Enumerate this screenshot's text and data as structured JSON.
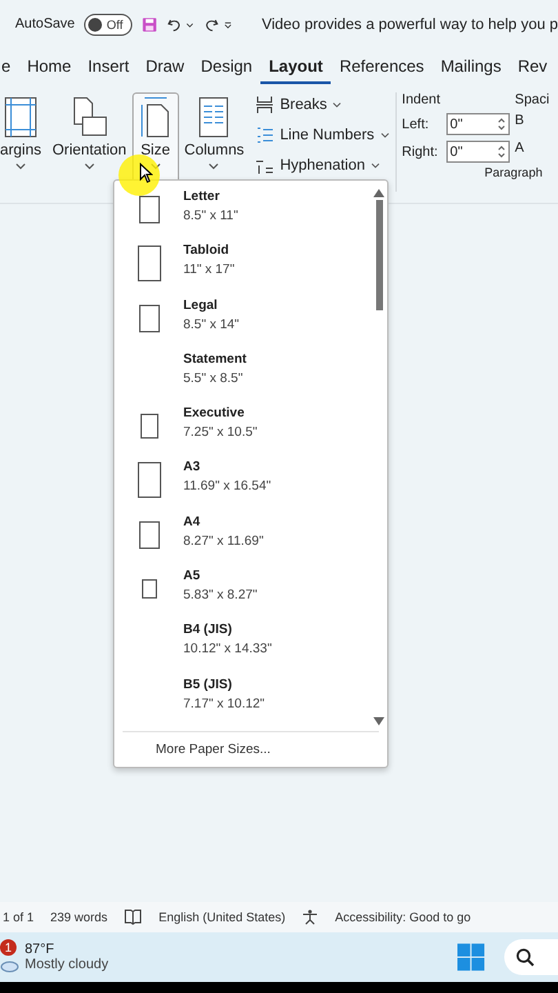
{
  "title_bar": {
    "autosave_label": "AutoSave",
    "autosave_toggle": {
      "on": false,
      "label": "Off"
    },
    "document_title": "Video provides a powerful way to help you p"
  },
  "tabs": [
    {
      "label": "e",
      "selected": false
    },
    {
      "label": "Home",
      "selected": false
    },
    {
      "label": "Insert",
      "selected": false
    },
    {
      "label": "Draw",
      "selected": false
    },
    {
      "label": "Design",
      "selected": false
    },
    {
      "label": "Layout",
      "selected": true
    },
    {
      "label": "References",
      "selected": false
    },
    {
      "label": "Mailings",
      "selected": false
    },
    {
      "label": "Rev",
      "selected": false
    }
  ],
  "ribbon": {
    "big_buttons": [
      {
        "label": "argins",
        "kind": "margins",
        "selected": false
      },
      {
        "label": "Orientation",
        "kind": "orientation",
        "selected": false
      },
      {
        "label": "Size",
        "kind": "size",
        "selected": true
      },
      {
        "label": "Columns",
        "kind": "columns",
        "selected": false
      }
    ],
    "small_buttons": [
      {
        "label": "Breaks",
        "kind": "breaks"
      },
      {
        "label": "Line Numbers",
        "kind": "lines"
      },
      {
        "label": "Hyphenation",
        "kind": "hyphen"
      }
    ],
    "indent": {
      "heading": "Indent",
      "left_label": "Left:",
      "left_value": "0\"",
      "right_label": "Right:",
      "right_value": "0\""
    },
    "spacing": {
      "heading": "Spaci",
      "before_label": "B",
      "after_label": "A"
    },
    "group_label": "Paragraph"
  },
  "size_menu": {
    "items": [
      {
        "name": "Letter",
        "size": "8.5\" x 11\"",
        "kind": "medium"
      },
      {
        "name": "Tabloid",
        "size": "11\" x 17\"",
        "kind": "large"
      },
      {
        "name": "Legal",
        "size": "8.5\" x 14\"",
        "kind": "medium"
      },
      {
        "name": "Statement",
        "size": "5.5\" x 8.5\"",
        "kind": "none"
      },
      {
        "name": "Executive",
        "size": "7.25\" x 10.5\"",
        "kind": "small"
      },
      {
        "name": "A3",
        "size": "11.69\" x 16.54\"",
        "kind": "large"
      },
      {
        "name": "A4",
        "size": "8.27\" x 11.69\"",
        "kind": "medium"
      },
      {
        "name": "A5",
        "size": "5.83\" x 8.27\"",
        "kind": "tiny"
      },
      {
        "name": "B4 (JIS)",
        "size": "10.12\" x 14.33\"",
        "kind": "none"
      },
      {
        "name": "B5 (JIS)",
        "size": "7.17\" x 10.12\"",
        "kind": "none"
      }
    ],
    "more": "More Paper Sizes..."
  },
  "status_bar": {
    "page": "1 of 1",
    "words": "239 words",
    "language": "English (United States)",
    "accessibility": "Accessibility: Good to go"
  },
  "taskbar": {
    "badge": "1",
    "temperature": "87°F",
    "weather": "Mostly cloudy"
  }
}
